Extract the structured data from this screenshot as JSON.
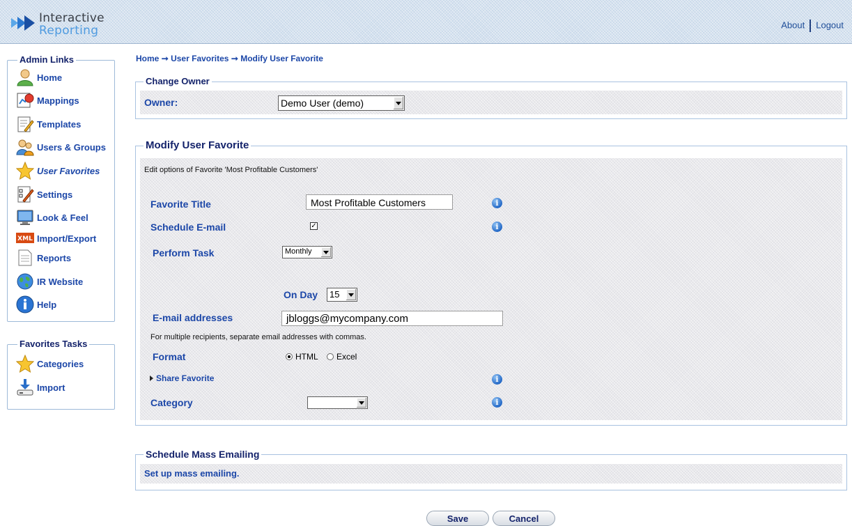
{
  "header": {
    "logo_line1": "Interactive",
    "logo_line2": "Reporting",
    "about": "About",
    "logout": "Logout"
  },
  "sidebar": {
    "admin_title": "Admin Links",
    "admin_items": [
      {
        "label": "Home",
        "icon": "user-icon"
      },
      {
        "label": "Mappings",
        "icon": "mappings-icon"
      },
      {
        "label": "Templates",
        "icon": "templates-icon"
      },
      {
        "label": "Users & Groups",
        "icon": "users-groups-icon"
      },
      {
        "label": "User Favorites",
        "icon": "star-icon",
        "active": true
      },
      {
        "label": "Settings",
        "icon": "settings-icon"
      },
      {
        "label": "Look & Feel",
        "icon": "monitor-icon"
      },
      {
        "label": "Import/Export",
        "icon": "xml-icon"
      },
      {
        "label": "Reports",
        "icon": "document-icon"
      },
      {
        "label": "IR Website",
        "icon": "globe-icon"
      },
      {
        "label": "Help",
        "icon": "info-icon"
      }
    ],
    "tasks_title": "Favorites Tasks",
    "task_items": [
      {
        "label": "Categories",
        "icon": "star-icon"
      },
      {
        "label": "Import",
        "icon": "import-icon"
      }
    ]
  },
  "breadcrumb": {
    "home": "Home",
    "sep": "➞",
    "favorites": "User Favorites",
    "current": "Modify User Favorite"
  },
  "change_owner": {
    "title": "Change Owner",
    "owner_label": "Owner:",
    "owner_value": "Demo User (demo)"
  },
  "modify": {
    "title": "Modify User Favorite",
    "description": "Edit options of Favorite 'Most Profitable Customers'",
    "favorite_title_label": "Favorite Title",
    "favorite_title_value": "Most Profitable Customers",
    "schedule_label": "Schedule E-mail",
    "schedule_checked": true,
    "perform_label": "Perform Task",
    "perform_value": "Monthly",
    "on_day_label": "On Day",
    "on_day_value": "15",
    "email_label": "E-mail addresses",
    "email_value": "jbloggs@mycompany.com",
    "email_hint": "For multiple recipients, separate email addresses with commas.",
    "format_label": "Format",
    "format_options": [
      "HTML",
      "Excel"
    ],
    "format_selected": "HTML",
    "share_label": "Share Favorite",
    "category_label": "Category",
    "category_value": ""
  },
  "mass": {
    "title": "Schedule Mass Emailing",
    "link": "Set up mass emailing."
  },
  "actions": {
    "save": "Save",
    "cancel": "Cancel"
  },
  "colors": {
    "header_bg": "#c9d9ea",
    "label_blue": "#1c47a8",
    "legend_navy": "#14236b",
    "panel_border": "#a8c2e0"
  }
}
